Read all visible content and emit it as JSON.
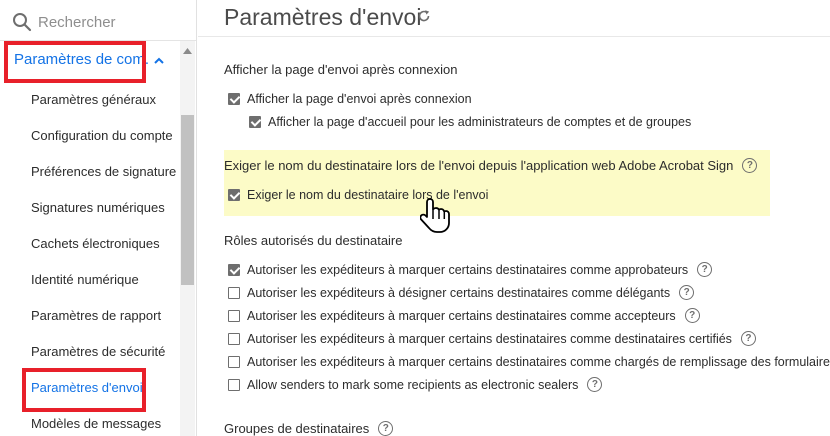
{
  "sidebar": {
    "search_placeholder": "Rechercher",
    "section_label": "Paramètres de com.",
    "items": [
      {
        "label": "Paramètres généraux"
      },
      {
        "label": "Configuration du compte"
      },
      {
        "label": "Préférences de signature"
      },
      {
        "label": "Signatures numériques"
      },
      {
        "label": "Cachets électroniques"
      },
      {
        "label": "Identité numérique"
      },
      {
        "label": "Paramètres de rapport"
      },
      {
        "label": "Paramètres de sécurité"
      },
      {
        "label": "Paramètres d'envoi",
        "active": true
      },
      {
        "label": "Modèles de messages"
      }
    ]
  },
  "main": {
    "title": "Paramètres d'envoi",
    "sections": {
      "send_page": {
        "title": "Afficher la page d'envoi après connexion",
        "options": [
          {
            "label": "Afficher la page d'envoi après connexion",
            "checked": true
          },
          {
            "label": "Afficher la page d'accueil pour les administrateurs de comptes et de groupes",
            "checked": true
          }
        ]
      },
      "require_name": {
        "title": "Exiger le nom du destinataire lors de l'envoi depuis l'application web Adobe Acrobat Sign",
        "options": [
          {
            "label": "Exiger le nom du destinataire lors de l'envoi",
            "checked": true
          }
        ]
      },
      "roles": {
        "title": "Rôles autorisés du destinataire",
        "options": [
          {
            "label": "Autoriser les expéditeurs à marquer certains destinataires comme approbateurs",
            "checked": true
          },
          {
            "label": "Autoriser les expéditeurs à désigner certains destinataires comme délégants",
            "checked": false
          },
          {
            "label": "Autoriser les expéditeurs à marquer certains destinataires comme accepteurs",
            "checked": false
          },
          {
            "label": "Autoriser les expéditeurs à marquer certains destinataires comme destinataires certifiés",
            "checked": false
          },
          {
            "label": "Autoriser les expéditeurs à marquer certains destinataires comme chargés de remplissage des formulaires",
            "checked": false
          },
          {
            "label": "Allow senders to mark some recipients as electronic sealers",
            "checked": false
          }
        ]
      },
      "groups": {
        "title": "Groupes de destinataires"
      }
    },
    "help_glyph": "?"
  },
  "colors": {
    "accent_blue": "#1473e6",
    "annotation_red": "#e8202a",
    "highlight_yellow": "#fcfbc7"
  }
}
